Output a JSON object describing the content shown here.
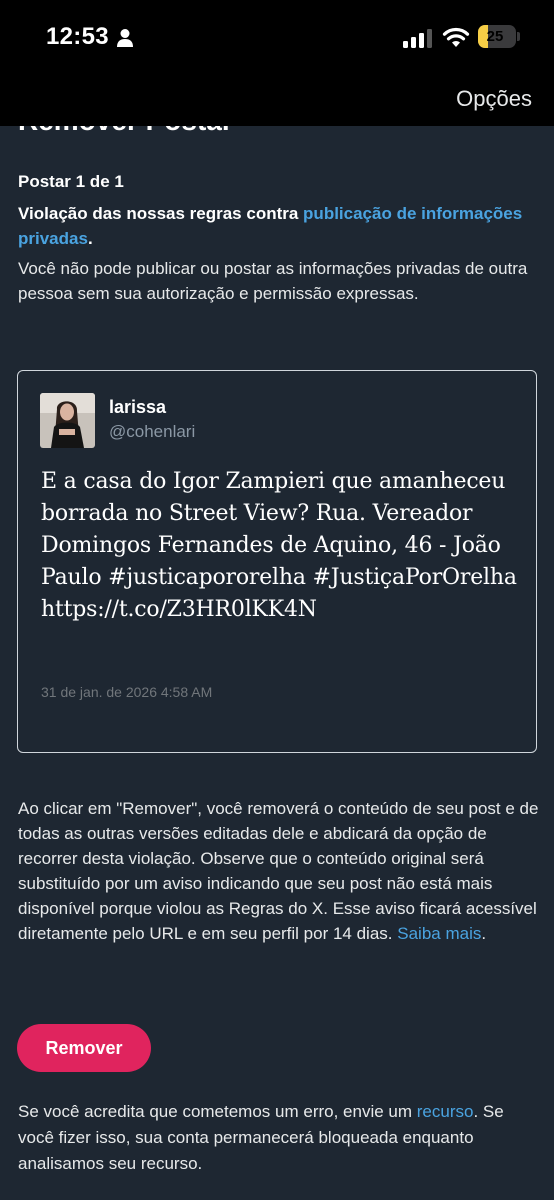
{
  "status_bar": {
    "time": "12:53",
    "battery_level": 25,
    "battery_text": "25",
    "battery_color": "#f7ce46"
  },
  "nav": {
    "options_label": "Opções"
  },
  "page": {
    "title": "Remover Postar",
    "post_count": "Postar 1 de 1",
    "violation_prefix": "Violação das nossas regras contra ",
    "violation_link": "publicação de informações privadas",
    "violation_suffix": ".",
    "violation_description": "Você não pode publicar ou postar as informações privadas de outra pessoa sem sua autorização e permissão expressas."
  },
  "tweet": {
    "author_name": "larissa",
    "author_handle": "@cohenlari",
    "text": "E a casa do Igor Zampieri que amanheceu borrada no Street View? Rua. Vereador Domingos Fernandes de Aquino, 46 - João Paulo #justicapororelha #JustiçaPorOrelha https://t.co/Z3HR0lKK4N",
    "date": "31 de jan. de 2026 4:58 AM"
  },
  "remove_info": {
    "text": "Ao clicar em \"Remover\", você removerá o conteúdo de seu post e de todas as outras versões editadas dele e abdicará da opção de recorrer desta violação. Observe que o conteúdo original será substituído por um aviso indicando que seu post não está mais disponível porque violou as Regras do X. Esse aviso ficará acessível diretamente pelo URL e em seu perfil por 14 dias. ",
    "link": "Saiba mais",
    "suffix": "."
  },
  "actions": {
    "remove_label": "Remover"
  },
  "appeal_info": {
    "prefix": "Se você acredita que cometemos um erro, envie um ",
    "link": "recurso",
    "suffix": ". Se você fizer isso, sua conta permanecerá bloqueada enquanto analisamos seu recurso."
  },
  "colors": {
    "background": "#1e2732",
    "link": "#4aa3e0",
    "remove_button": "#e0245e",
    "card_border": "#d0d6dc"
  },
  "icons": [
    "person-icon",
    "signal-icon",
    "wifi-icon",
    "battery-icon",
    "avatar"
  ]
}
